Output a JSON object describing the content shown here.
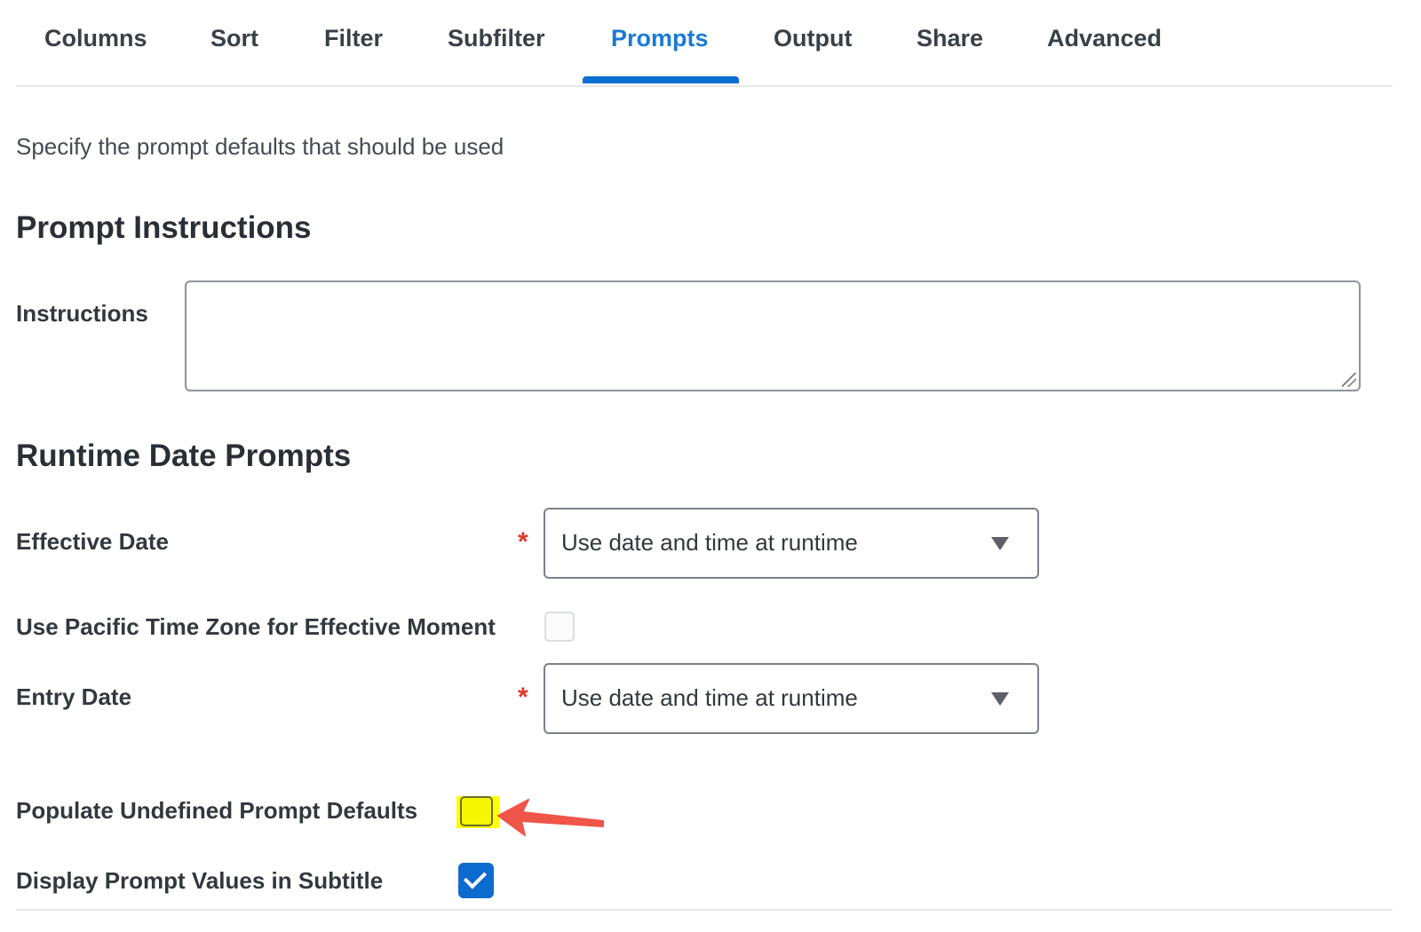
{
  "tabs": [
    {
      "label": "Columns"
    },
    {
      "label": "Sort"
    },
    {
      "label": "Filter"
    },
    {
      "label": "Subfilter"
    },
    {
      "label": "Prompts",
      "active": true
    },
    {
      "label": "Output"
    },
    {
      "label": "Share"
    },
    {
      "label": "Advanced"
    }
  ],
  "intro_text": "Specify the prompt defaults that should be used",
  "prompt_instructions": {
    "title": "Prompt Instructions",
    "instructions_label": "Instructions",
    "instructions_value": ""
  },
  "runtime_date_prompts": {
    "title": "Runtime Date Prompts",
    "effective_date": {
      "label": "Effective Date",
      "required": "*",
      "value": "Use date and time at runtime"
    },
    "pacific_time_zone": {
      "label": "Use Pacific Time Zone for Effective Moment",
      "checked": false
    },
    "entry_date": {
      "label": "Entry Date",
      "required": "*",
      "value": "Use date and time at runtime"
    },
    "populate_undefined": {
      "label": "Populate Undefined Prompt Defaults",
      "checked": false,
      "highlighted": true
    },
    "display_prompt_values": {
      "label": "Display Prompt Values in Subtitle",
      "checked": true
    }
  },
  "icons": {
    "dropdown": "chevron-down-icon",
    "check": "check-icon",
    "annotation": "red-arrow-icon"
  },
  "colors": {
    "accent": "#0b6fd1",
    "active_tab": "#1a7ad4",
    "required": "#de3a30",
    "highlight": "#ffff00",
    "annotation_arrow": "#f0554a"
  }
}
